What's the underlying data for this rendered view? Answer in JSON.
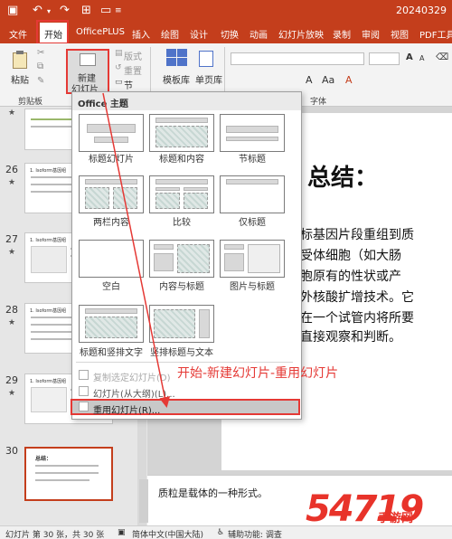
{
  "titlebar": {
    "filename": "20240329"
  },
  "menu": {
    "tabs": [
      "文件",
      "开始",
      "OfficePLUS",
      "插入",
      "绘图",
      "设计",
      "切换",
      "动画",
      "幻灯片放映",
      "录制",
      "审阅",
      "视图",
      "PDF工具"
    ],
    "active": "开始"
  },
  "ribbon": {
    "paste": "粘贴",
    "new_slide_line1": "新建",
    "new_slide_line2": "幻灯片",
    "layout": "版式",
    "reset": "重置",
    "section": "节",
    "template_lib": "模板库",
    "single_page_lib": "单页库",
    "groups": {
      "clipboard": "剪贴板",
      "font": "字体"
    }
  },
  "dropdown": {
    "header": "Office 主题",
    "layouts": [
      "标题幻灯片",
      "标题和内容",
      "节标题",
      "两栏内容",
      "比较",
      "仅标题",
      "空白",
      "内容与标题",
      "图片与标题",
      "标题和竖排文字",
      "竖排标题与文本"
    ],
    "menu_items": {
      "duplicate": "复制选定幻灯片(D)",
      "from_outline": "幻灯片(从大纲)(L)...",
      "reuse": "重用幻灯片(R)..."
    }
  },
  "thumbnails": [
    {
      "number": "26",
      "tag": "1. Isoform基因组"
    },
    {
      "number": "27",
      "tag": "1. Isoform基因组"
    },
    {
      "number": "28",
      "tag": "1. Isoform基因组"
    },
    {
      "number": "29",
      "tag": "1. Isoform基因组"
    },
    {
      "number": "30",
      "tag": "总结："
    }
  ],
  "slide": {
    "title": "总结：",
    "lines": [
      "某种目标基因片段重组到质",
      "，转入受体细胞（如大肠",
      "宿主细胞原有的性状或产",
      "术是体外核酸扩增技术。它",
      "点；能在一个试管内将所要",
      "肉眼能直接观察和判断。"
    ]
  },
  "notes": {
    "text": "质粒是载体的一种形式。"
  },
  "annotation": {
    "callout": "开始-新建幻灯片-重用幻灯片"
  },
  "statusbar": {
    "slide_info": "幻灯片 第 30 张，共 30 张",
    "language": "简体中文(中国大陆)",
    "accessibility": "辅助功能: 调查"
  },
  "watermark": {
    "big": "54719",
    "small": "手游网"
  },
  "colors": {
    "accent": "#c43e1c",
    "highlight": "#e53935"
  }
}
